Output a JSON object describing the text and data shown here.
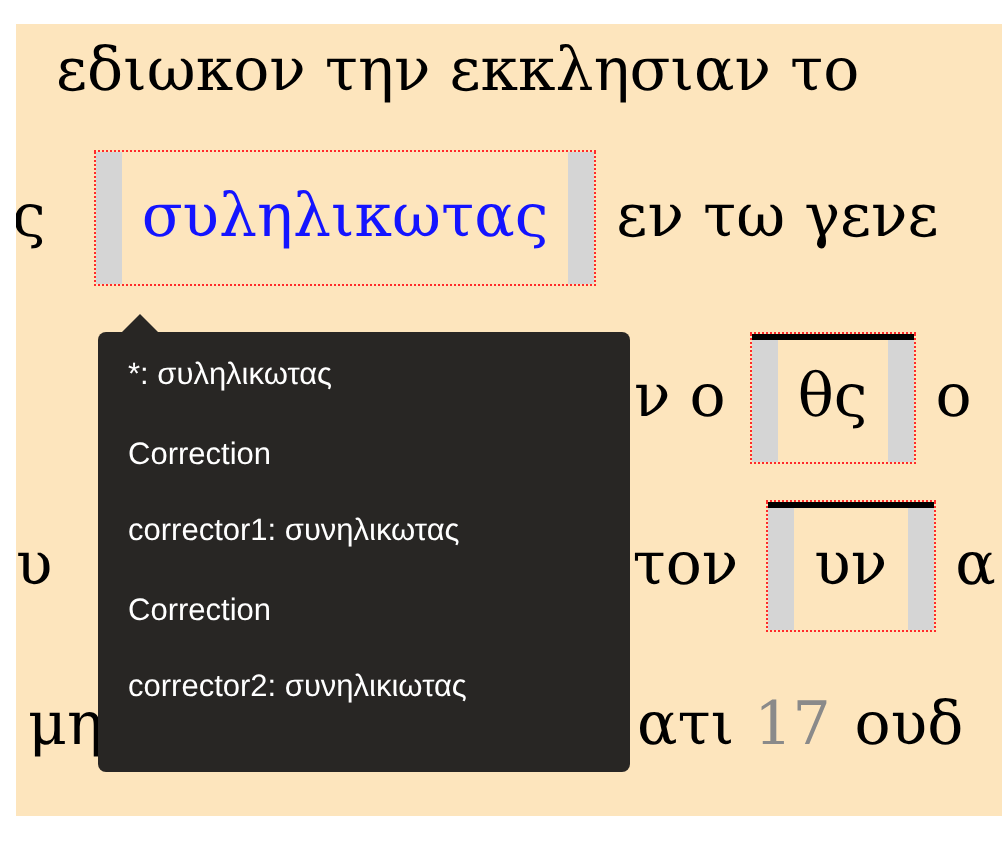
{
  "lines": [
    {
      "segments": [
        {
          "kind": "text",
          "text": "εδιωκον την εκκλησιαν το"
        }
      ]
    },
    {
      "segments": [
        {
          "kind": "text",
          "text": "ς"
        },
        {
          "kind": "variant",
          "text": "συληλικωτας"
        },
        {
          "kind": "text",
          "text": "εν τω γενε"
        }
      ]
    },
    {
      "segments": [
        {
          "kind": "text",
          "text": "ν ο"
        },
        {
          "kind": "nomen-sacrum",
          "text": "θς"
        },
        {
          "kind": "text",
          "text": "ο"
        }
      ]
    },
    {
      "segments": [
        {
          "kind": "text",
          "text": "υ"
        },
        {
          "kind": "text",
          "text": "τον"
        },
        {
          "kind": "nomen-sacrum",
          "text": "υν"
        },
        {
          "kind": "text",
          "text": "α"
        }
      ]
    },
    {
      "segments": [
        {
          "kind": "text",
          "text": "μη"
        },
        {
          "kind": "text",
          "text": "ατι"
        },
        {
          "kind": "number",
          "text": "17"
        },
        {
          "kind": "text",
          "text": "ουδ"
        }
      ]
    }
  ],
  "tooltip": {
    "reading": "*: συληλικωτας",
    "corrections": [
      {
        "heading": "Correction",
        "text": "corrector1: συνηλικωτας"
      },
      {
        "heading": "Correction",
        "text": "corrector2: συνηλικιωτας"
      }
    ]
  }
}
